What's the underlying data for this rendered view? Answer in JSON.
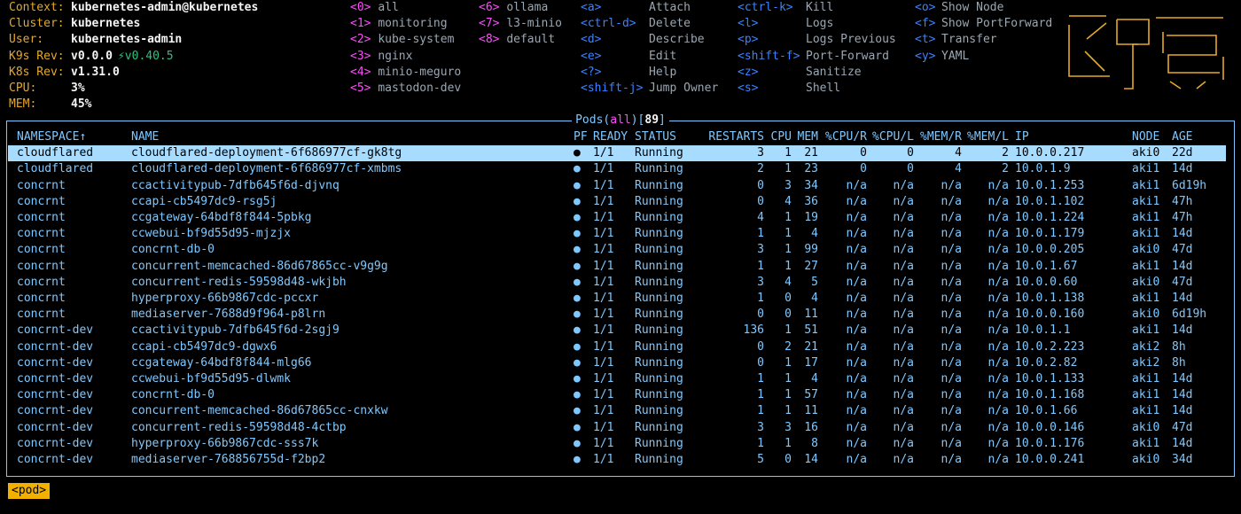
{
  "info": [
    {
      "key": "Context:",
      "value": "kubernetes-admin@kubernetes"
    },
    {
      "key": "Cluster:",
      "value": "kubernetes"
    },
    {
      "key": "User:",
      "value": "kubernetes-admin"
    },
    {
      "key": "K9s Rev:",
      "value": "v0.0.0",
      "extra": "⚡v0.40.5"
    },
    {
      "key": "K8s Rev:",
      "value": "v1.31.0"
    },
    {
      "key": "CPU:",
      "value": "3%"
    },
    {
      "key": "MEM:",
      "value": "45%"
    }
  ],
  "namespaces": [
    {
      "key": "<0>",
      "label": "all"
    },
    {
      "key": "<1>",
      "label": "monitoring"
    },
    {
      "key": "<2>",
      "label": "kube-system"
    },
    {
      "key": "<3>",
      "label": "nginx"
    },
    {
      "key": "<4>",
      "label": "minio-meguro"
    },
    {
      "key": "<5>",
      "label": "mastodon-dev"
    },
    {
      "key": "<6>",
      "label": "ollama"
    },
    {
      "key": "<7>",
      "label": "l3-minio"
    },
    {
      "key": "<8>",
      "label": "default"
    }
  ],
  "shortcuts_col1": [
    {
      "key": "<a>",
      "label": "Attach"
    },
    {
      "key": "<ctrl-d>",
      "label": "Delete"
    },
    {
      "key": "<d>",
      "label": "Describe"
    },
    {
      "key": "<e>",
      "label": "Edit"
    },
    {
      "key": "<?>",
      "label": "Help"
    },
    {
      "key": "<shift-j>",
      "label": "Jump Owner"
    }
  ],
  "shortcuts_col2": [
    {
      "key": "<ctrl-k>",
      "label": "Kill"
    },
    {
      "key": "<l>",
      "label": "Logs"
    },
    {
      "key": "<p>",
      "label": "Logs Previous"
    },
    {
      "key": "<shift-f>",
      "label": "Port-Forward"
    },
    {
      "key": "<z>",
      "label": "Sanitize"
    },
    {
      "key": "<s>",
      "label": "Shell"
    }
  ],
  "shortcuts_col3": [
    {
      "key": "<o>",
      "label": "Show Node"
    },
    {
      "key": "<f>",
      "label": "Show PortForward"
    },
    {
      "key": "<t>",
      "label": "Transfer"
    },
    {
      "key": "<y>",
      "label": "YAML"
    }
  ],
  "logo_text": "K9s",
  "table": {
    "title_resource": "Pods",
    "title_scope": "all",
    "title_count": "89",
    "headers": [
      "NAMESPACE↑",
      "NAME",
      "PF",
      "READY",
      "STATUS",
      "RESTARTS",
      "CPU",
      "MEM",
      "%CPU/R",
      "%CPU/L",
      "%MEM/R",
      "%MEM/L",
      "IP",
      "NODE",
      "AGE"
    ],
    "rows": [
      [
        "cloudflared",
        "cloudflared-deployment-6f686977cf-gk8tg",
        "●",
        "1/1",
        "Running",
        "3",
        "1",
        "21",
        "0",
        "0",
        "4",
        "2",
        "10.0.0.217",
        "aki0",
        "22d"
      ],
      [
        "cloudflared",
        "cloudflared-deployment-6f686977cf-xmbms",
        "●",
        "1/1",
        "Running",
        "2",
        "1",
        "23",
        "0",
        "0",
        "4",
        "2",
        "10.0.1.9",
        "aki1",
        "14d"
      ],
      [
        "concrnt",
        "ccactivitypub-7dfb645f6d-djvnq",
        "●",
        "1/1",
        "Running",
        "0",
        "3",
        "34",
        "n/a",
        "n/a",
        "n/a",
        "n/a",
        "10.0.1.253",
        "aki1",
        "6d19h"
      ],
      [
        "concrnt",
        "ccapi-cb5497dc9-rsg5j",
        "●",
        "1/1",
        "Running",
        "0",
        "4",
        "36",
        "n/a",
        "n/a",
        "n/a",
        "n/a",
        "10.0.1.102",
        "aki1",
        "47h"
      ],
      [
        "concrnt",
        "ccgateway-64bdf8f844-5pbkg",
        "●",
        "1/1",
        "Running",
        "4",
        "1",
        "19",
        "n/a",
        "n/a",
        "n/a",
        "n/a",
        "10.0.1.224",
        "aki1",
        "47h"
      ],
      [
        "concrnt",
        "ccwebui-bf9d55d95-mjzjx",
        "●",
        "1/1",
        "Running",
        "1",
        "1",
        "4",
        "n/a",
        "n/a",
        "n/a",
        "n/a",
        "10.0.1.179",
        "aki1",
        "14d"
      ],
      [
        "concrnt",
        "concrnt-db-0",
        "●",
        "1/1",
        "Running",
        "3",
        "1",
        "99",
        "n/a",
        "n/a",
        "n/a",
        "n/a",
        "10.0.0.205",
        "aki0",
        "47d"
      ],
      [
        "concrnt",
        "concurrent-memcached-86d67865cc-v9g9g",
        "●",
        "1/1",
        "Running",
        "1",
        "1",
        "27",
        "n/a",
        "n/a",
        "n/a",
        "n/a",
        "10.0.1.67",
        "aki1",
        "14d"
      ],
      [
        "concrnt",
        "concurrent-redis-59598d48-wkjbh",
        "●",
        "1/1",
        "Running",
        "3",
        "4",
        "5",
        "n/a",
        "n/a",
        "n/a",
        "n/a",
        "10.0.0.60",
        "aki0",
        "47d"
      ],
      [
        "concrnt",
        "hyperproxy-66b9867cdc-pccxr",
        "●",
        "1/1",
        "Running",
        "1",
        "0",
        "4",
        "n/a",
        "n/a",
        "n/a",
        "n/a",
        "10.0.1.138",
        "aki1",
        "14d"
      ],
      [
        "concrnt",
        "mediaserver-7688d9f964-p8lrn",
        "●",
        "1/1",
        "Running",
        "0",
        "0",
        "11",
        "n/a",
        "n/a",
        "n/a",
        "n/a",
        "10.0.0.160",
        "aki0",
        "6d19h"
      ],
      [
        "concrnt-dev",
        "ccactivitypub-7dfb645f6d-2sgj9",
        "●",
        "1/1",
        "Running",
        "136",
        "1",
        "51",
        "n/a",
        "n/a",
        "n/a",
        "n/a",
        "10.0.1.1",
        "aki1",
        "14d"
      ],
      [
        "concrnt-dev",
        "ccapi-cb5497dc9-dgwx6",
        "●",
        "1/1",
        "Running",
        "0",
        "2",
        "21",
        "n/a",
        "n/a",
        "n/a",
        "n/a",
        "10.0.2.223",
        "aki2",
        "8h"
      ],
      [
        "concrnt-dev",
        "ccgateway-64bdf8f844-mlg66",
        "●",
        "1/1",
        "Running",
        "0",
        "1",
        "17",
        "n/a",
        "n/a",
        "n/a",
        "n/a",
        "10.0.2.82",
        "aki2",
        "8h"
      ],
      [
        "concrnt-dev",
        "ccwebui-bf9d55d95-dlwmk",
        "●",
        "1/1",
        "Running",
        "1",
        "1",
        "4",
        "n/a",
        "n/a",
        "n/a",
        "n/a",
        "10.0.1.133",
        "aki1",
        "14d"
      ],
      [
        "concrnt-dev",
        "concrnt-db-0",
        "●",
        "1/1",
        "Running",
        "1",
        "1",
        "57",
        "n/a",
        "n/a",
        "n/a",
        "n/a",
        "10.0.1.168",
        "aki1",
        "14d"
      ],
      [
        "concrnt-dev",
        "concurrent-memcached-86d67865cc-cnxkw",
        "●",
        "1/1",
        "Running",
        "1",
        "1",
        "11",
        "n/a",
        "n/a",
        "n/a",
        "n/a",
        "10.0.1.66",
        "aki1",
        "14d"
      ],
      [
        "concrnt-dev",
        "concurrent-redis-59598d48-4ctbp",
        "●",
        "1/1",
        "Running",
        "3",
        "3",
        "16",
        "n/a",
        "n/a",
        "n/a",
        "n/a",
        "10.0.0.146",
        "aki0",
        "47d"
      ],
      [
        "concrnt-dev",
        "hyperproxy-66b9867cdc-sss7k",
        "●",
        "1/1",
        "Running",
        "1",
        "1",
        "8",
        "n/a",
        "n/a",
        "n/a",
        "n/a",
        "10.0.1.176",
        "aki1",
        "14d"
      ],
      [
        "concrnt-dev",
        "mediaserver-768856755d-f2bp2",
        "●",
        "1/1",
        "Running",
        "5",
        "0",
        "14",
        "n/a",
        "n/a",
        "n/a",
        "n/a",
        "10.0.0.241",
        "aki0",
        "34d"
      ]
    ],
    "selected_row": 0
  },
  "breadcrumb": "<pod>",
  "colors": {
    "accent_blue": "#7fc8ff",
    "key_magenta": "#ff4cff",
    "key_blue": "#3b82ff",
    "label_gold": "#e6a829",
    "selection": "#a7dcff",
    "crumb": "#f2b000"
  }
}
